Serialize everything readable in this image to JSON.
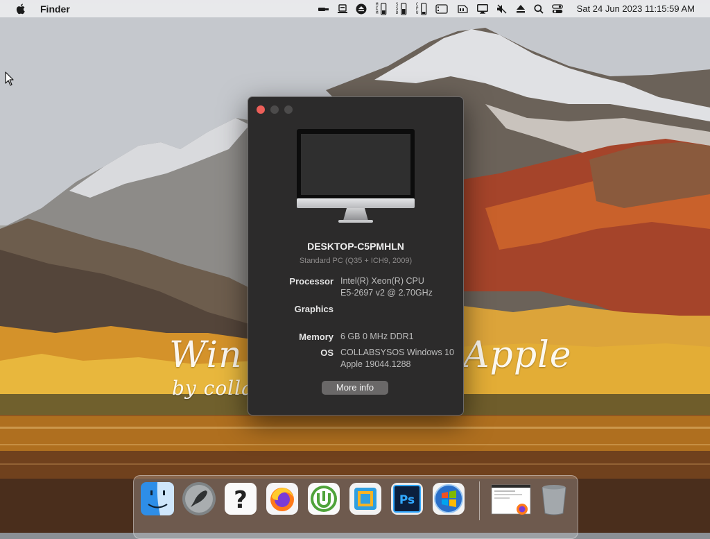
{
  "menubar": {
    "app_name": "Finder",
    "status_icons": [
      "usb-stick-icon",
      "network-drive-icon",
      "eject-circle-icon",
      "memory-meter-icon",
      "ssd-meter-icon",
      "cpu-meter-icon",
      "cards-icon",
      "battery-icon",
      "display-icon",
      "mute-icon",
      "eject-icon",
      "search-icon",
      "control-center-icon"
    ],
    "mem_label": "MEM",
    "ssd_label": "SSD",
    "cpu_label": "CPU",
    "clock": "Sat 24 Jun 2023  11:15:59 AM"
  },
  "wallpaper": {
    "watermark_left": "Win",
    "watermark_sub": "by colla",
    "watermark_right": "Apple"
  },
  "about_window": {
    "computer_name": "DESKTOP-C5PMHLN",
    "model": "Standard PC (Q35 + ICH9, 2009)",
    "specs": {
      "processor_label": "Processor",
      "processor_value_line1": "Intel(R) Xeon(R) CPU",
      "processor_value_line2": "E5-2697 v2 @ 2.70GHz",
      "graphics_label": "Graphics",
      "graphics_value": "",
      "memory_label": "Memory",
      "memory_value": "6 GB  0 MHz DDR1",
      "os_label": "OS",
      "os_value_line1": "COLLABSYSOS Windows 10",
      "os_value_line2": "Apple 19044.1288"
    },
    "more_info_button": "More info",
    "colors": {
      "close": "#ed5f59",
      "background": "#2c2b2b"
    }
  },
  "dock": {
    "items": [
      {
        "name": "finder-icon"
      },
      {
        "name": "launchpad-icon"
      },
      {
        "name": "help-icon"
      },
      {
        "name": "firefox-icon"
      },
      {
        "name": "utorrent-icon"
      },
      {
        "name": "files-app-icon"
      },
      {
        "name": "photoshop-icon"
      },
      {
        "name": "windows-icon"
      },
      {
        "name": "firefox-window-thumbnail"
      },
      {
        "name": "trash-icon"
      }
    ],
    "photoshop_label": "Ps",
    "help_label": "?"
  }
}
